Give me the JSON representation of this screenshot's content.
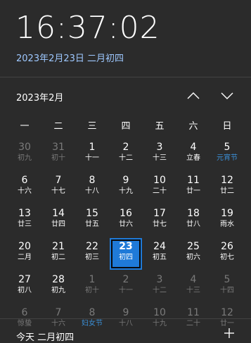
{
  "clock": {
    "time": "16:37:02",
    "date": "2023年2月23日 二月初四"
  },
  "calendar": {
    "month_label": "2023年2月",
    "weekdays": [
      "一",
      "二",
      "三",
      "四",
      "五",
      "六",
      "日"
    ],
    "days": [
      {
        "n": "30",
        "l": "初九",
        "dim": true
      },
      {
        "n": "31",
        "l": "初十",
        "dim": true
      },
      {
        "n": "1",
        "l": "十一"
      },
      {
        "n": "2",
        "l": "十二"
      },
      {
        "n": "3",
        "l": "十三"
      },
      {
        "n": "4",
        "l": "立春"
      },
      {
        "n": "5",
        "l": "元宵节",
        "festival": true
      },
      {
        "n": "6",
        "l": "十六"
      },
      {
        "n": "7",
        "l": "十七"
      },
      {
        "n": "8",
        "l": "十八"
      },
      {
        "n": "9",
        "l": "十九"
      },
      {
        "n": "10",
        "l": "二十"
      },
      {
        "n": "11",
        "l": "廿一"
      },
      {
        "n": "12",
        "l": "廿二"
      },
      {
        "n": "13",
        "l": "廿三"
      },
      {
        "n": "14",
        "l": "廿四"
      },
      {
        "n": "15",
        "l": "廿五"
      },
      {
        "n": "16",
        "l": "廿六"
      },
      {
        "n": "17",
        "l": "廿七"
      },
      {
        "n": "18",
        "l": "廿八"
      },
      {
        "n": "19",
        "l": "雨水"
      },
      {
        "n": "20",
        "l": "二月"
      },
      {
        "n": "21",
        "l": "初二"
      },
      {
        "n": "22",
        "l": "初三"
      },
      {
        "n": "23",
        "l": "初四",
        "today": true
      },
      {
        "n": "24",
        "l": "初五"
      },
      {
        "n": "25",
        "l": "初六"
      },
      {
        "n": "26",
        "l": "初七"
      },
      {
        "n": "27",
        "l": "初八"
      },
      {
        "n": "28",
        "l": "初九"
      },
      {
        "n": "1",
        "l": "初十",
        "dim": true
      },
      {
        "n": "2",
        "l": "十一",
        "dim": true
      },
      {
        "n": "3",
        "l": "十二",
        "dim": true
      },
      {
        "n": "4",
        "l": "十三",
        "dim": true
      },
      {
        "n": "5",
        "l": "十四",
        "dim": true
      },
      {
        "n": "6",
        "l": "惊蛰",
        "dim": true
      },
      {
        "n": "7",
        "l": "十六",
        "dim": true
      },
      {
        "n": "8",
        "l": "妇女节",
        "dim": true,
        "festival": true
      },
      {
        "n": "9",
        "l": "十八",
        "dim": true
      },
      {
        "n": "10",
        "l": "十九",
        "dim": true
      },
      {
        "n": "11",
        "l": "二十",
        "dim": true
      },
      {
        "n": "12",
        "l": "廿一",
        "dim": true
      }
    ]
  },
  "footer": {
    "label": "今天 二月初四"
  },
  "icons": {
    "up": "chevron-up-icon",
    "down": "chevron-down-icon",
    "add": "plus-icon"
  }
}
